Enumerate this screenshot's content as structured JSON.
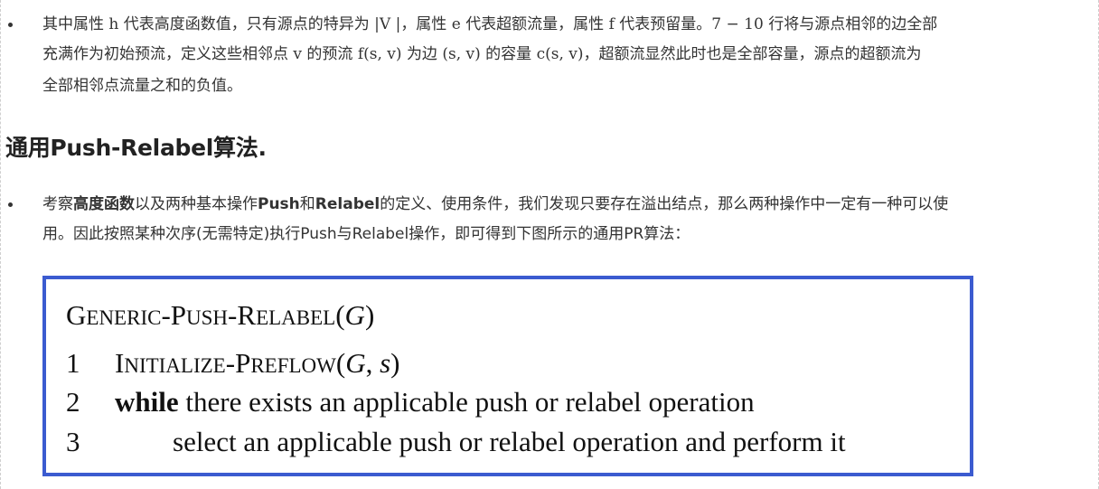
{
  "para1": {
    "line1_pre": "其中属性",
    "line1_h": "h",
    "line1_mid1": "代表高度函数值，只有源点的特异为",
    "line1_V": "|V |",
    "line1_mid2": "，属性",
    "line1_e": "e",
    "line1_mid3": "代表超额流量，属性",
    "line1_f": "f",
    "line1_mid4": "代表预留量。",
    "line1_range": "7 − 10",
    "line1_post": "行将与源点相邻的边全部",
    "line2_pre": "充满作为初始预流，定义这些相邻点",
    "line2_v": "v",
    "line2_mid1": "的预流",
    "line2_fsv": "f(s, v)",
    "line2_mid2": "为边",
    "line2_sv": "(s, v)",
    "line2_mid3": "的容量",
    "line2_csv": "c(s, v)",
    "line2_post": "，超额流显然此时也是全部容量，源点的超额流为",
    "line3": "全部相邻点流量之和的负值。"
  },
  "heading": {
    "text": "通用Push-Relabel算法."
  },
  "para2": {
    "line1_pre": "考察",
    "line1_bold1": "高度函数",
    "line1_mid1": "以及两种基本操作",
    "line1_bold2": "Push",
    "line1_mid2": "和",
    "line1_bold3": "Relabel",
    "line1_post": "的定义、使用条件，我们发现只要存在溢出结点，那么两种操作中一定有一种可以使",
    "line2": "用。因此按照某种次序(无需特定)执行Push与Relabel操作，即可得到下图所示的通用PR算法："
  },
  "algorithm": {
    "title_G1": "G",
    "title_rest1": "ENERIC",
    "title_dash1": "-",
    "title_P1": "P",
    "title_rest2": "USH",
    "title_dash2": "-",
    "title_R1": "R",
    "title_rest3": "ELABEL",
    "title_args": "(",
    "title_arg_G": "G",
    "title_close": ")",
    "lines": [
      {
        "num": "1",
        "I": "I",
        "init_rest": "NITIALIZE",
        "dash": "-",
        "P": "P",
        "pre_rest": "REFLOW",
        "open": "(",
        "arg1": "G",
        "comma": ", ",
        "arg2": "s",
        "close": ")"
      },
      {
        "num": "2",
        "keyword": "while",
        "text": " there exists an applicable push or relabel operation"
      },
      {
        "num": "3",
        "text": "select an applicable push or relabel operation and perform it"
      }
    ]
  },
  "colors": {
    "box_border": "#3b5bd0",
    "text": "#333333"
  }
}
